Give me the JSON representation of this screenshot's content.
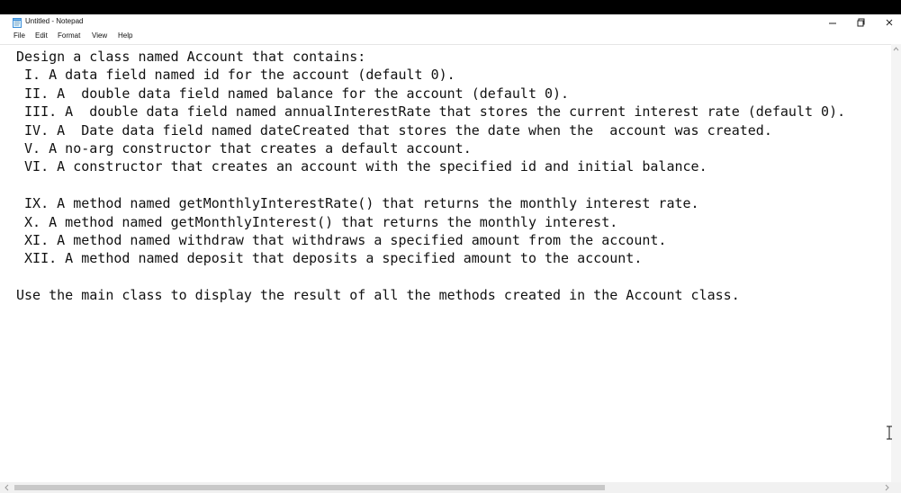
{
  "window": {
    "title": "Untitled - Notepad",
    "controls": {
      "minimize": "—",
      "maximize": "❐",
      "close": "✕"
    }
  },
  "menu": {
    "items": [
      "File",
      "Edit",
      "Format",
      "View",
      "Help"
    ]
  },
  "editor": {
    "text": "Design a class named Account that contains:\n I. A data field named id for the account (default 0).\n II. A  double data field named balance for the account (default 0).\n III. A  double data field named annualInterestRate that stores the current interest rate (default 0).\n IV. A  Date data field named dateCreated that stores the date when the  account was created.\n V. A no-arg constructor that creates a default account.\n VI. A constructor that creates an account with the specified id and initial balance.\n\n IX. A method named getMonthlyInterestRate() that returns the monthly interest rate.\n X. A method named getMonthlyInterest() that returns the monthly interest.\n XI. A method named withdraw that withdraws a specified amount from the account.\n XII. A method named deposit that deposits a specified amount to the account.\n\nUse the main class to display the result of all the methods created in the Account class."
  },
  "icons": {
    "app": "notepad-icon",
    "scroll_up": "scroll-up-arrow-icon",
    "scroll_left": "scroll-left-arrow-icon",
    "scroll_right": "scroll-right-arrow-icon",
    "cursor": "text-cursor-icon"
  }
}
